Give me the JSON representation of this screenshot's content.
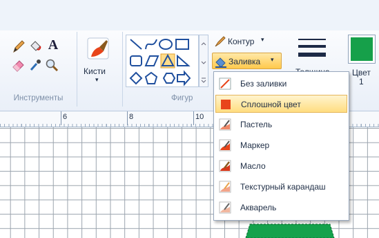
{
  "ribbon": {
    "groups": {
      "tools": {
        "label": "Инструменты"
      },
      "brushes": {
        "label": "Кисти"
      },
      "shapes": {
        "label": "Фигур"
      },
      "size": {
        "label": "Толщина"
      },
      "color1": {
        "label": "Цвет",
        "sub": "1",
        "swatch": "#16a04a"
      }
    },
    "tool_glyphs": {
      "text": "A"
    },
    "outline_label": "Контур",
    "fill_label": "Заливка",
    "dropdown_arrow": "▾"
  },
  "ruler": {
    "ticks": [
      "6",
      "8",
      "10"
    ]
  },
  "fill_menu": {
    "items": [
      {
        "label": "Без заливки",
        "icon": "no-fill-icon"
      },
      {
        "label": "Сплошной цвет",
        "icon": "solid-color-icon",
        "selected": true
      },
      {
        "label": "Пастель",
        "icon": "crayon-icon"
      },
      {
        "label": "Маркер",
        "icon": "marker-icon"
      },
      {
        "label": "Масло",
        "icon": "oil-icon"
      },
      {
        "label": "Текстурный карандаш",
        "icon": "pencil-texture-icon"
      },
      {
        "label": "Акварель",
        "icon": "watercolor-icon"
      }
    ]
  },
  "colors": {
    "accent_fill": "#e8451b",
    "shape_fill": "#14a24c",
    "selection": "#ffdd80"
  }
}
